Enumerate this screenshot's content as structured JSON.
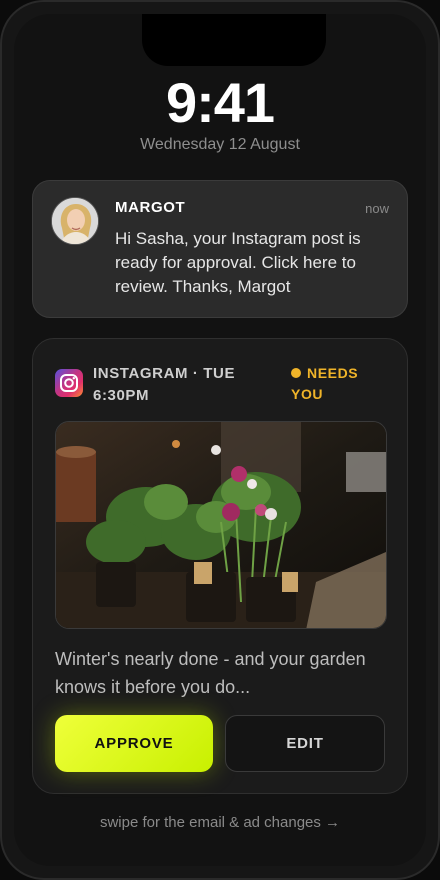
{
  "lockscreen": {
    "time": "9:41",
    "date": "Wednesday 12 August"
  },
  "notification": {
    "sender": "MARGOT",
    "time_ago": "now",
    "message": "Hi Sasha, your Instagram post is ready for approval. Click here to review. Thanks, Margot"
  },
  "post_card": {
    "platform_schedule": "INSTAGRAM · TUE 6:30PM",
    "status": "NEEDS YOU",
    "status_color": "#f0b429",
    "image_subject": "potted flowering plants",
    "caption": "Winter's nearly done - and your garden knows it before you do...",
    "approve_label": "APPROVE",
    "edit_label": "EDIT",
    "accent_color": "#d9ff1a"
  },
  "footer": {
    "swipe_hint": "swipe for the email & ad changes →"
  }
}
